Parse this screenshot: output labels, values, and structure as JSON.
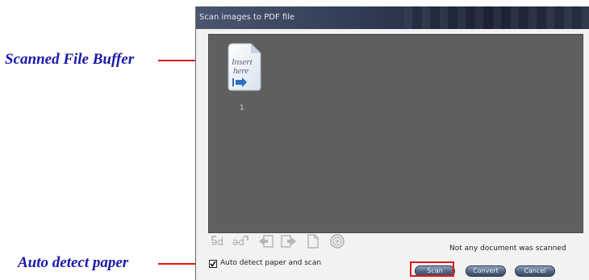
{
  "callouts": {
    "buffer": "Scanned File Buffer",
    "autodetect": "Auto detect paper"
  },
  "window": {
    "title": "Scan images to PDF file"
  },
  "buffer": {
    "thumbnail_text_line1": "Insert",
    "thumbnail_text_line2": "here",
    "thumbnail_index": "1"
  },
  "toolbar": {
    "icons": [
      "rotate-left-icon",
      "rotate-right-icon",
      "move-back-icon",
      "move-forward-icon",
      "delete-page-icon",
      "zoom-icon"
    ]
  },
  "status": {
    "message": "Not any document was scanned"
  },
  "options": {
    "auto_detect_label": "Auto detect paper and scan",
    "auto_detect_checked": true
  },
  "buttons": {
    "scan": "Scan",
    "convert": "Convert",
    "cancel": "Cancel"
  },
  "colors": {
    "callout_text": "#1a1aa8",
    "callout_line": "#e01818",
    "buffer_bg": "#5f5f5f"
  }
}
